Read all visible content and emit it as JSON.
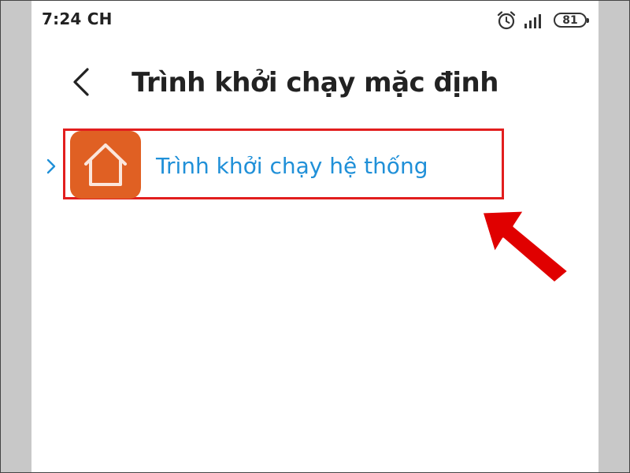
{
  "status_bar": {
    "time": "7:24 CH",
    "battery_level": "81",
    "alarm_icon": "alarm-clock-icon",
    "signal_icon": "signal-bars-icon"
  },
  "header": {
    "back_icon": "chevron-left-icon",
    "title": "Trình khởi chạy mặc định"
  },
  "launchers": [
    {
      "label": "Trình khởi chạy hệ thống",
      "icon": "home-icon",
      "icon_color": "#e06023",
      "label_color": "#2090d8",
      "highlighted": true
    }
  ],
  "annotation": {
    "highlight_color": "#e21e1e",
    "arrow_color": "#e00000"
  }
}
